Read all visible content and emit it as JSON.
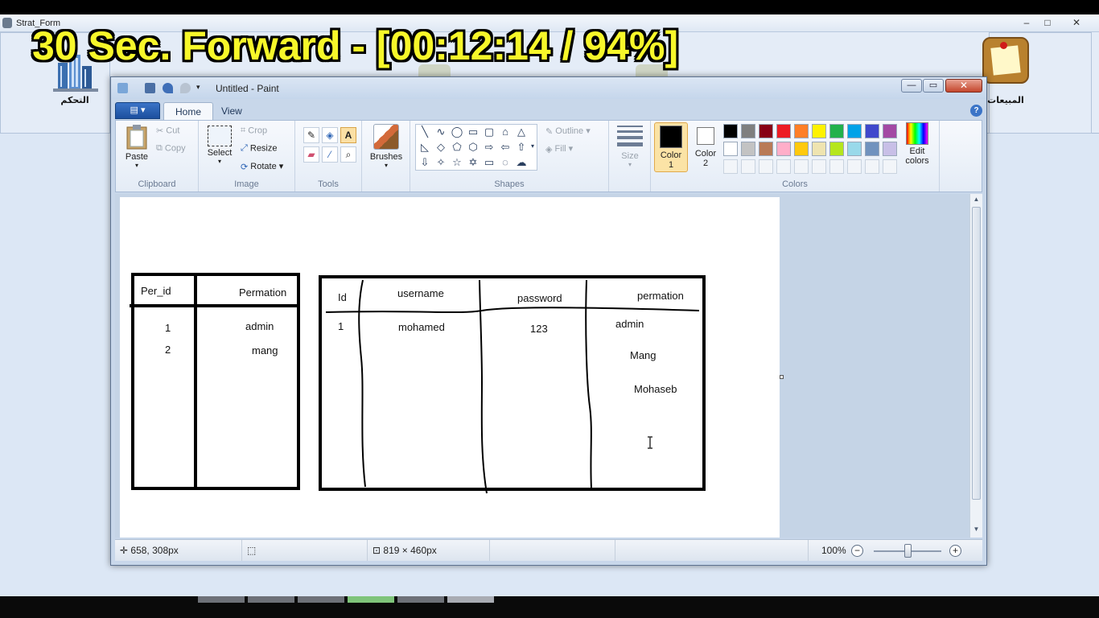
{
  "overlay": {
    "banner_text": "30 Sec. Forward - [00:12:14 / 94%]"
  },
  "outer_window": {
    "title": "Strat_Form",
    "left_icon_label": "التحكم",
    "right_icon_label": "المبيعات",
    "controls": {
      "minimize": "–",
      "maximize": "□",
      "close": "✕"
    }
  },
  "paint": {
    "title": "Untitled - Paint",
    "window_controls": {
      "minimize": "—",
      "maximize": "▭",
      "close": "✕"
    },
    "tabs": {
      "app_menu": "▤ ▾",
      "home": "Home",
      "view": "View",
      "help": "?"
    },
    "clipboard": {
      "paste": "Paste",
      "cut": "Cut",
      "copy": "Copy",
      "group": "Clipboard"
    },
    "image": {
      "select": "Select",
      "crop": "Crop",
      "resize": "Resize",
      "rotate": "Rotate",
      "group": "Image"
    },
    "tools": {
      "group": "Tools"
    },
    "brushes": {
      "label": "Brushes"
    },
    "shapes": {
      "outline": "Outline",
      "fill": "Fill",
      "group": "Shapes"
    },
    "size": {
      "label": "Size"
    },
    "colors": {
      "color1_label": "Color",
      "color1_num": "1",
      "color2_label": "Color",
      "color2_num": "2",
      "edit_colors_line1": "Edit",
      "edit_colors_line2": "colors",
      "group": "Colors",
      "color1_value": "#000000",
      "color2_value": "#ffffff",
      "palette_row1": [
        "#000000",
        "#7f7f7f",
        "#880015",
        "#ed1c24",
        "#ff7f27",
        "#fff200",
        "#22b14c",
        "#00a2e8",
        "#3f48cc",
        "#a349a4"
      ],
      "palette_row2": [
        "#ffffff",
        "#c3c3c3",
        "#b97a57",
        "#ffaec9",
        "#ffc90e",
        "#efe4b0",
        "#b5e61d",
        "#99d9ea",
        "#7092be",
        "#c8bfe7"
      ]
    },
    "canvas": {
      "table1": {
        "headers": [
          "Per_id",
          "Permation"
        ],
        "rows": [
          [
            "1",
            "admin"
          ],
          [
            "2",
            "mang"
          ]
        ]
      },
      "table2": {
        "headers": [
          "Id",
          "username",
          "password",
          "permation"
        ],
        "row": [
          "1",
          "mohamed",
          "123",
          "admin"
        ],
        "extra_permations": [
          "Mang",
          "Mohaseb"
        ]
      }
    },
    "status": {
      "cursor_position": "658, 308px",
      "image_size": "819 × 460px",
      "zoom": "100%"
    }
  }
}
